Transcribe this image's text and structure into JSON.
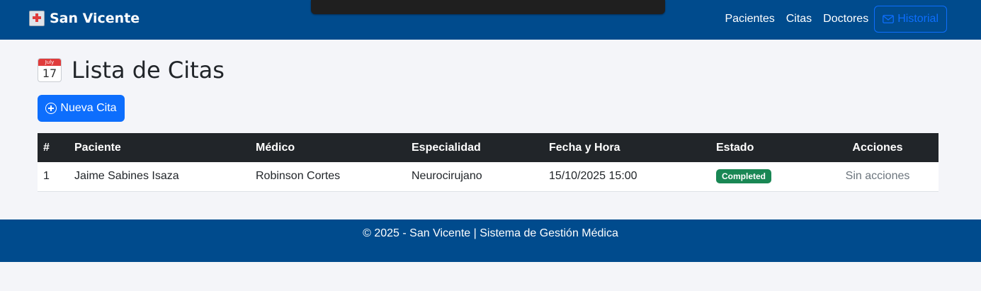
{
  "navbar": {
    "brand": "San Vicente",
    "links": [
      "Pacientes",
      "Citas",
      "Doctores"
    ],
    "historial_label": "Historial",
    "bg_color": "#004b8d"
  },
  "page": {
    "title": "Lista de Citas",
    "calendar_icon": {
      "month": "July",
      "day": "17"
    },
    "new_button_label": "Nueva Cita"
  },
  "table": {
    "headers": [
      "#",
      "Paciente",
      "Médico",
      "Especialidad",
      "Fecha y Hora",
      "Estado",
      "Acciones"
    ],
    "rows": [
      {
        "num": "1",
        "paciente": "Jaime Sabines Isaza",
        "medico": "Robinson Cortes",
        "especialidad": "Neurocirujano",
        "fecha_hora": "15/10/2025 15:00",
        "estado": "Completed",
        "acciones": "Sin acciones"
      }
    ]
  },
  "footer": {
    "text": "© 2025 - San Vicente | Sistema de Gestión Médica"
  },
  "colors": {
    "primary": "#0d6efd",
    "success": "#198754",
    "dark": "#212529"
  }
}
